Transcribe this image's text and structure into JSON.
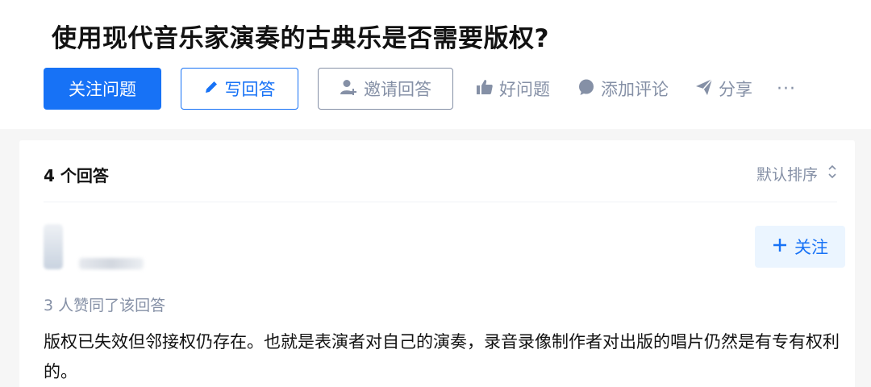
{
  "question": {
    "title": "使用现代音乐家演奏的古典乐是否需要版权?"
  },
  "actions": {
    "follow_question": "关注问题",
    "write_answer": "写回答",
    "invite_answer": "邀请回答",
    "good_question": "好问题",
    "add_comment": "添加评论",
    "share": "分享",
    "more": "···"
  },
  "answers": {
    "count_label": "4 个回答",
    "sort_label": "默认排序",
    "items": [
      {
        "follow_label": "关注",
        "voters_label": "3 人赞同了该回答",
        "content": "版权已失效但邻接权仍存在。也就是表演者对自己的演奏，录音录像制作者对出版的唱片仍然是有专有权利的。"
      }
    ]
  },
  "colors": {
    "primary": "#1772f6",
    "muted": "#8590a6",
    "follow_bg": "#ebf5ff"
  }
}
